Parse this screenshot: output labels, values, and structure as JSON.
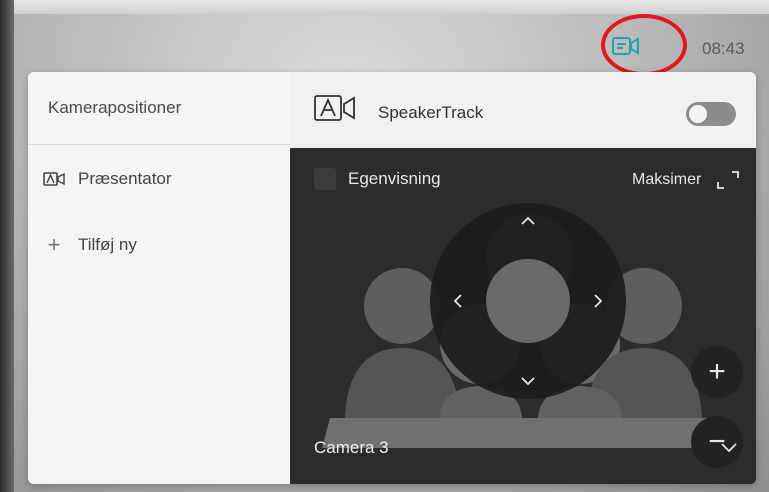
{
  "status_bar": {
    "time": "08:43",
    "camera_icon": "camera-settings-icon",
    "highlight_color": "#e1171b"
  },
  "sidebar": {
    "title": "Kamerapositioner",
    "items": [
      {
        "label": "Præsentator",
        "icon": "presenter-icon"
      },
      {
        "label": "Tilføj ny",
        "icon": "plus-icon"
      }
    ]
  },
  "header": {
    "speakertrack_label": "SpeakerTrack",
    "speakertrack_on": false
  },
  "viewer": {
    "self_view_label": "Egenvisning",
    "maximize_label": "Maksimer",
    "zoom_in": "+",
    "zoom_out": "−",
    "camera_select": "Camera 3"
  },
  "colors": {
    "panel_bg": "#f1f1f1",
    "viewer_bg": "#2c2c2c",
    "toggle_off": "#8c8c8c"
  }
}
